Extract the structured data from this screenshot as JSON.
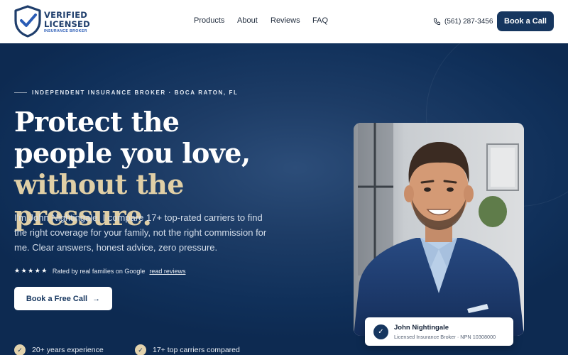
{
  "brand": {
    "line1": "VERIFIED",
    "line2": "LICENSED",
    "line3": "INSURANCE BROKER",
    "icon": "shield-check-icon",
    "color": "#1f3e6c"
  },
  "nav": {
    "items": [
      {
        "label": "Products"
      },
      {
        "label": "About"
      },
      {
        "label": "Reviews"
      },
      {
        "label": "FAQ"
      }
    ]
  },
  "header": {
    "phone_icon": "phone-icon",
    "phone": "(561) 287-3456",
    "cta": "Book a Call"
  },
  "hero": {
    "eyebrow": "INDEPENDENT INSURANCE BROKER · BOCA RATON, FL",
    "headline_part1": "Protect the people you love,",
    "headline_part2": "without the pressure.",
    "subtext": "I'm John Nightingale. I compare 17+ top-rated carriers to find the right coverage for your family, not the right commission for me. Clear answers, honest advice, zero pressure.",
    "rating": {
      "stars": "★★★★★",
      "text": "Rated by real families on Google",
      "link": "read reviews"
    },
    "cta": "Book a Free Call",
    "cta_arrow": "→",
    "features": [
      {
        "check": "✓",
        "text": "20+ years experience"
      },
      {
        "check": "✓",
        "text": "17+ top carriers compared"
      }
    ]
  },
  "profile": {
    "check": "✓",
    "name": "John Nightingale",
    "details": "Licensed Insurance Broker · NPN 10308000"
  },
  "colors": {
    "navy": "#16365f",
    "hero_bg": "#10305a",
    "gold": "#e0cfa6",
    "white": "#ffffff"
  }
}
